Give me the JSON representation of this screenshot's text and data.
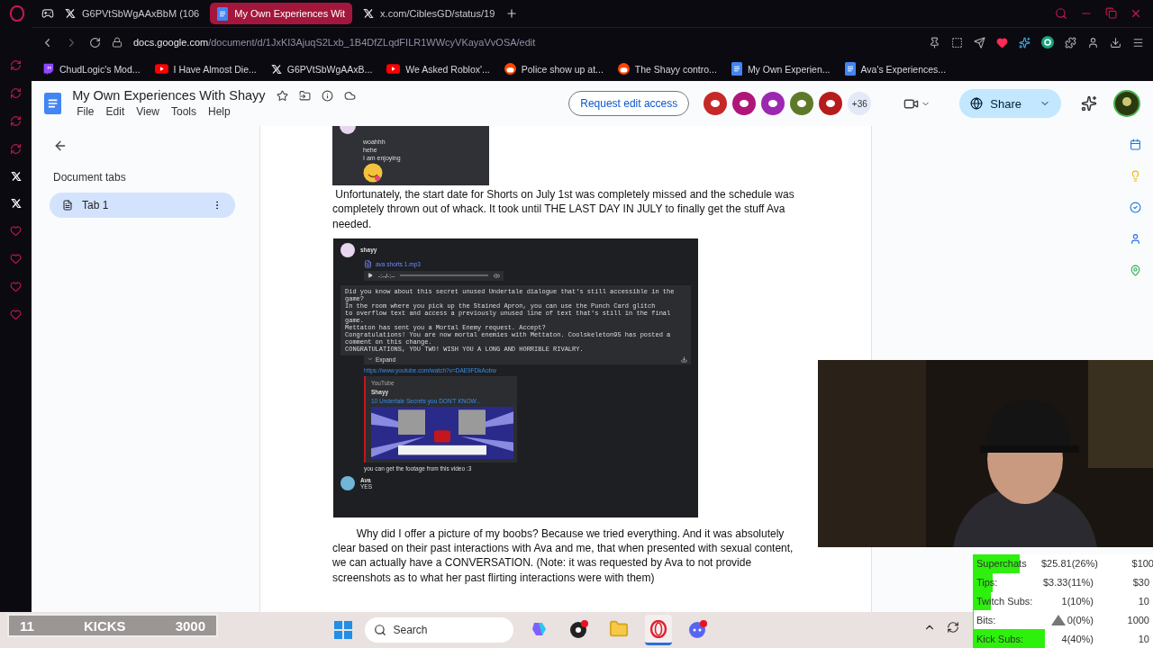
{
  "browser": {
    "tabs": [
      {
        "title": "G6PVtSbWgAAxBbM (106",
        "kind": "x",
        "selected": false
      },
      {
        "title": "My Own Experiences Wit",
        "kind": "doc",
        "selected": true
      },
      {
        "title": "x.com/CiblesGD/status/19",
        "kind": "x",
        "selected": false
      }
    ],
    "url": {
      "host": "docs.google.com",
      "path": "/document/d/1JxKI3AjuqS2Lxb_1B4DfZLqdFILR1WWcyVKayaVvOSA/edit"
    },
    "bookmarks": [
      {
        "title": "ChudLogic's Mod...",
        "kind": "twitch"
      },
      {
        "title": "I Have Almost Die...",
        "kind": "youtube"
      },
      {
        "title": "G6PVtSbWgAAxB...",
        "kind": "x"
      },
      {
        "title": "We Asked Roblox'...",
        "kind": "youtube"
      },
      {
        "title": "Police show up at...",
        "kind": "reddit"
      },
      {
        "title": "The Shayy contro...",
        "kind": "reddit"
      },
      {
        "title": "My Own Experien...",
        "kind": "doc"
      },
      {
        "title": "Ava's Experiences...",
        "kind": "doc"
      }
    ]
  },
  "docs": {
    "title": "My Own Experiences With Shayy",
    "menu": [
      "File",
      "Edit",
      "View",
      "Tools",
      "Help"
    ],
    "request_button": "Request edit access",
    "collaborators": [
      {
        "color": "#c62828"
      },
      {
        "color": "#b0167a"
      },
      {
        "color": "#9c27b0"
      },
      {
        "color": "#5d7a2a"
      },
      {
        "color": "#b71c1c"
      }
    ],
    "more_collaborators": "+36",
    "share_button": "Share"
  },
  "sidebar": {
    "heading": "Document tabs",
    "tabs": [
      {
        "label": "Tab 1",
        "selected": true
      }
    ]
  },
  "document": {
    "blocks": [
      {
        "kind": "chat_image",
        "lines": [
          "woahhh",
          "hehe",
          "I am enjoying"
        ]
      },
      {
        "kind": "paragraph",
        "text": " Unfortunately, the start date for Shorts on July 1st was completely missed and the schedule was completely thrown out of whack. It took until THE LAST DAY IN JULY to finally get the stuff Ava needed."
      },
      {
        "kind": "message_image",
        "author": "shayy",
        "file": "ava shorts 1.mp3",
        "time": "-:--/-:--",
        "code": [
          "Did you know about this secret unused Undertale dialogue that's still accessible in the game?",
          "In the room where you pick up the Stained Apron, you can use the Punch Card glitch",
          "to overflow text and access a previously unused line of text that's still in the final game.",
          "Mettaton has sent you a Mortal Enemy request. Accept?",
          "Congratulations! You are now mortal enemies with Mettaton. Coolskeleton95 has posted a comment on this change.",
          "CONGRATULATIONS, YOU TWO! WISH YOU A LONG AND HORRIBLE RIVALRY."
        ],
        "expand": "Expand",
        "link": "https://www.youtube.com/watch?v=DAE9FDkAobw",
        "embed_site": "YouTube",
        "embed_author": "Shayy",
        "embed_title": "10 Undertale Secrets you DON'T KNOW...",
        "caption": "you can get the footage from this video :3",
        "reply_author": "Ava",
        "reply_text": "YES"
      },
      {
        "kind": "paragraph",
        "text": "        Why did I offer a picture of my boobs? Because we tried everything. And it was absolutely clear based on their past interactions with Ava and me, that when presented with sexual content, we can actually have a CONVERSATION. (Note: it was requested by Ava to not provide screenshots as to what her past flirting interactions were with them)"
      }
    ]
  },
  "stream": {
    "goals": [
      {
        "label": "Superchats",
        "value": "$25.81(26%)",
        "target": "$100",
        "level": 0.26
      },
      {
        "label": "Tips:",
        "value": "$3.33(11%)",
        "target": "$30",
        "level": 0.11
      },
      {
        "label": "Twitch Subs:",
        "value": "1(10%)",
        "target": "10",
        "level": 0.1
      },
      {
        "label": "Bits:",
        "value": "0(0%)",
        "target": "1000",
        "level": 0
      },
      {
        "label": "Kick Subs:",
        "value": "4(40%)",
        "target": "10",
        "level": 0.4
      }
    ],
    "kicks": {
      "count": "11",
      "label": "KICKS",
      "goal": "3000"
    }
  },
  "taskbar": {
    "search_placeholder": "Search",
    "apps": [
      {
        "kind": "copilot",
        "selected": false
      },
      {
        "kind": "obs",
        "selected": false
      },
      {
        "kind": "files",
        "selected": false
      },
      {
        "kind": "opera",
        "selected": true
      },
      {
        "kind": "discord",
        "selected": false
      }
    ]
  }
}
